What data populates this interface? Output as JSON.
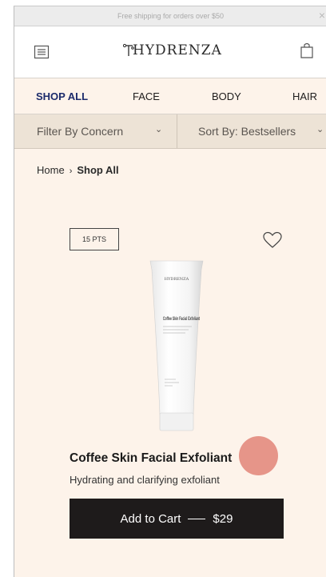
{
  "promo": {
    "text": "Free shipping for orders over $50",
    "close": "×"
  },
  "header": {
    "brand": "HYDRENZA"
  },
  "nav": {
    "items": [
      "SHOP ALL",
      "FACE",
      "BODY",
      "HAIR"
    ]
  },
  "filters": {
    "concern": "Filter By Concern",
    "sort": "Sort By: Bestsellers"
  },
  "breadcrumb": {
    "home": "Home",
    "current": "Shop All"
  },
  "product": {
    "points": "15 PTS",
    "title": "Coffee Skin Facial Exfoliant",
    "subtitle": "Hydrating and clarifying exfoliant",
    "tube_brand": "HYDRENZA",
    "tube_name": "Coffee Skin Facial Exfoliant",
    "cart_label": "Add to Cart",
    "price": "$29"
  },
  "icons": [
    "menu-icon",
    "logo-icon",
    "shopping-bag-icon",
    "chevron-right-icon",
    "chevron-down-icon",
    "heart-icon",
    "close-icon"
  ],
  "colors": {
    "background": "#fdf3ea",
    "filter_bar": "#ede3d6",
    "nav_active": "#1c2b6b",
    "button": "#1e1b1b",
    "cursor": "#de7668"
  }
}
